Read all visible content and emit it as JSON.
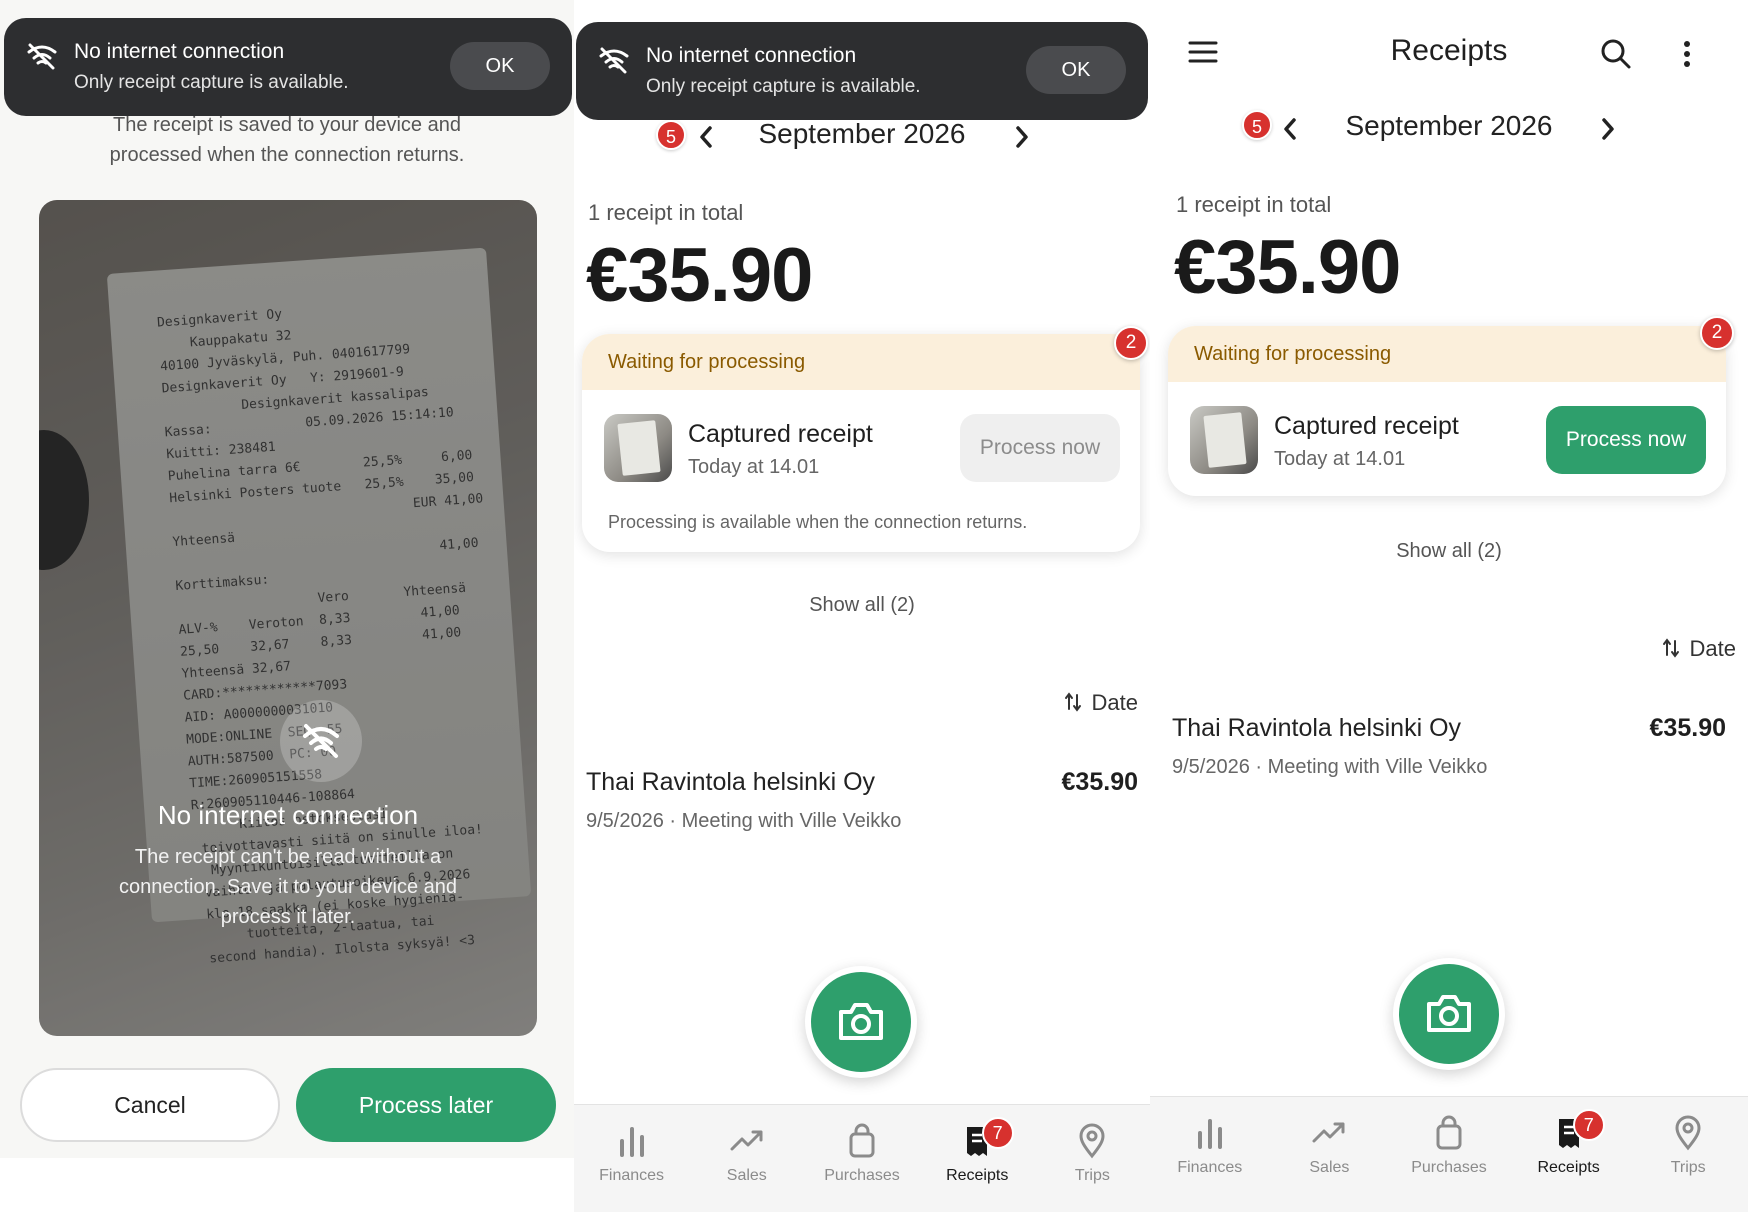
{
  "toast": {
    "title": "No internet connection",
    "subtitle": "Only receipt capture is available.",
    "ok_label": "OK"
  },
  "capture_screen": {
    "saved_message_line1": "The receipt is saved to your device and",
    "saved_message_line2": "processed when the connection returns.",
    "overlay_title": "No internet connection",
    "overlay_text": "The receipt can't be read without a connection. Save it to your device and process it later.",
    "cancel_label": "Cancel",
    "process_later_label": "Process later",
    "receipt_photo_text": "Designkaverit Oy\n    Kauppakatu 32\n40100 Jyväskylä, Puh. 0401617799\nDesignkaverit Oy   Y: 2919601-9\n          Designkaverit kassalipas\nKassa:            05.09.2026 15:14:10\nKuitti: 238481\nPuhelina tarra 6€        25,5%     6,00\nHelsinki Posters tuote   25,5%    35,00\n                               EUR 41,00\nYhteensä\n                                  41,00\nKorttimaksu:\n                  Vero       Yhteensä\nALV-%    Veroton  8,33         41,00\n25,50    32,67    8,33         41,00\nYhteensä 32,67\nCARD:************7093\nAID: A0000000031010\nMODE:ONLINE  SEQ: 55\nAUTH:587500  PC: 00\nTIME:260905151558\nR:260905110446-108864\n      Kiitos ostoksestasi,\n toivottavasti siitä on sinulle iloa!\n  Myyntikuntoisilla tuotteilla on\n vaihto- ja palautusoikeus 6.9.2026\n klo 18 saakka (ei koske hygienia-\n      tuotteita, 2-laatua, tai\n second handia). Ilolsta syksyä! <3"
  },
  "receipts": {
    "app_title": "Receipts",
    "month": "September 2026",
    "month_badge": "5",
    "total_label": "1 receipt in total",
    "total_amount": "€35.90",
    "waiting": {
      "header": "Waiting for processing",
      "badge": "2",
      "item_title": "Captured receipt",
      "item_time": "Today at 14.01",
      "process_now_label": "Process now",
      "offline_note": "Processing is available when the connection returns."
    },
    "show_all_label": "Show all (2)",
    "sort_label": "Date",
    "items": [
      {
        "name": "Thai Ravintola helsinki Oy",
        "meta": "9/5/2026 · Meeting with Ville Veikko",
        "amount": "€35.90"
      }
    ]
  },
  "nav": {
    "items": [
      {
        "label": "Finances",
        "icon": "bar-chart-icon"
      },
      {
        "label": "Sales",
        "icon": "trending-up-icon"
      },
      {
        "label": "Purchases",
        "icon": "shopping-bag-icon"
      },
      {
        "label": "Receipts",
        "icon": "receipt-icon",
        "badge": "7"
      },
      {
        "label": "Trips",
        "icon": "map-pin-icon"
      }
    ]
  },
  "colors": {
    "accent_green": "#2e9f6c",
    "badge_red": "#d7312e",
    "waiting_bg": "#fbefdb",
    "waiting_text": "#8a5a00",
    "toast_bg": "#2d2e30"
  }
}
